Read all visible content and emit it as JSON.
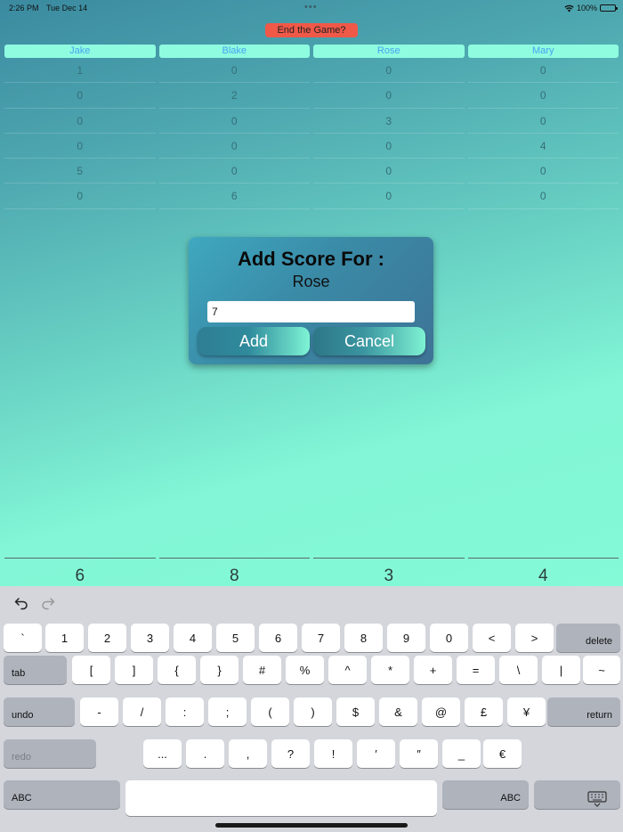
{
  "status": {
    "time": "2:26 PM",
    "date": "Tue Dec 14",
    "battery": "100%"
  },
  "end_game_label": "End the Game?",
  "players": [
    "Jake",
    "Blake",
    "Rose",
    "Mary"
  ],
  "scores": [
    [
      "1",
      "0",
      "0",
      "0"
    ],
    [
      "0",
      "2",
      "0",
      "0"
    ],
    [
      "0",
      "0",
      "3",
      "0"
    ],
    [
      "0",
      "0",
      "0",
      "4"
    ],
    [
      "5",
      "0",
      "0",
      "0"
    ],
    [
      "0",
      "6",
      "0",
      "0"
    ]
  ],
  "totals": [
    "6",
    "8",
    "3",
    "4"
  ],
  "dialog": {
    "title": "Add Score For :",
    "player_name": "Rose",
    "input_value": "7",
    "add_label": "Add",
    "cancel_label": "Cancel"
  },
  "keyboard": {
    "toolbar_icons": [
      "undo-icon",
      "redo-icon"
    ],
    "row1": [
      "`",
      "1",
      "2",
      "3",
      "4",
      "5",
      "6",
      "7",
      "8",
      "9",
      "0",
      "<",
      ">",
      "delete"
    ],
    "row2": [
      "tab",
      "[",
      "]",
      "{",
      "}",
      "#",
      "%",
      "^",
      "*",
      "+",
      "=",
      "\\",
      "|",
      "~"
    ],
    "row3": [
      "undo",
      "-",
      "/",
      ":",
      ";",
      "(",
      ")",
      "$",
      "&",
      "@",
      "£",
      "¥",
      "return"
    ],
    "row4": [
      "redo",
      "...",
      ".",
      ",",
      "?",
      "!",
      "′",
      "″",
      "_",
      "€"
    ],
    "row5": [
      "ABC",
      "",
      "ABC",
      "keyboard-dismiss-icon"
    ]
  }
}
